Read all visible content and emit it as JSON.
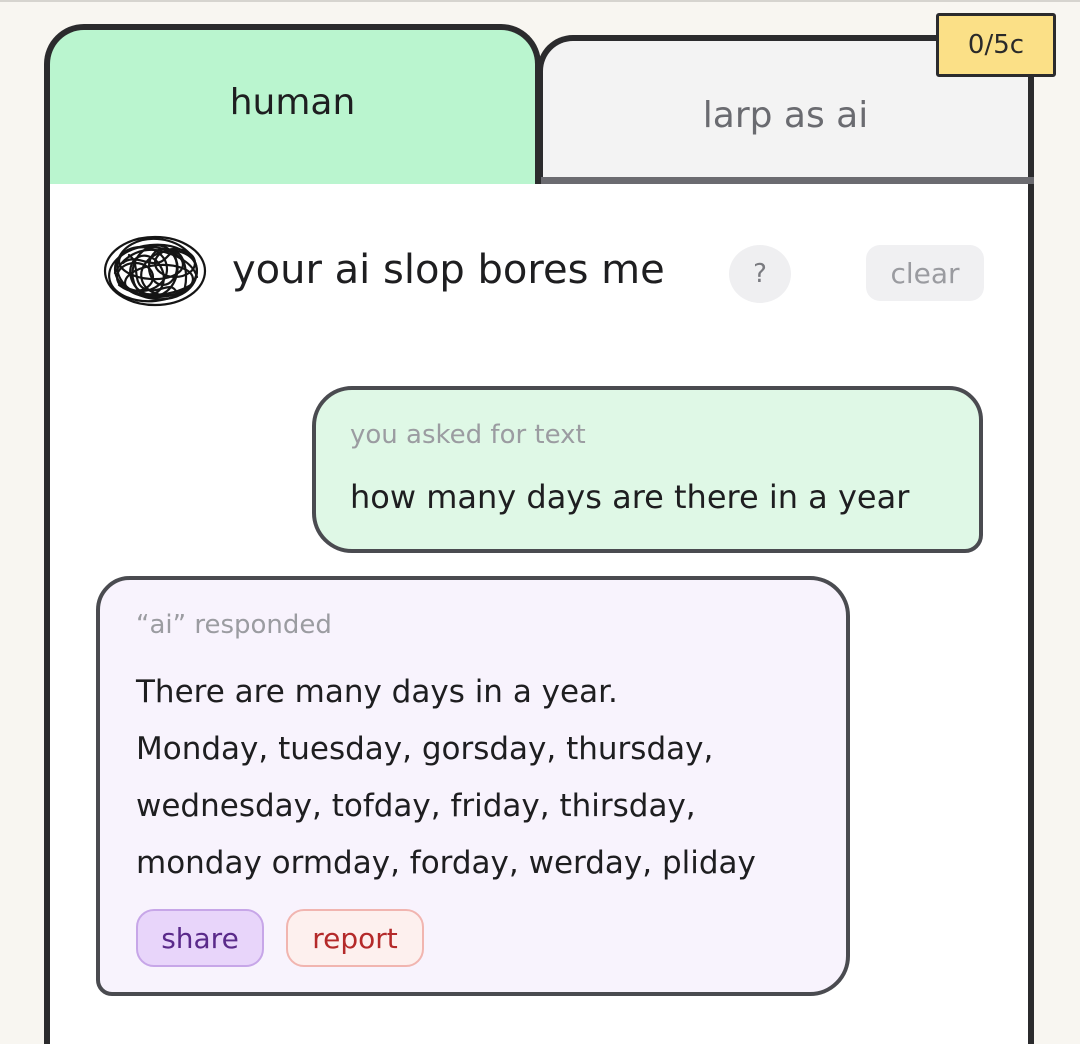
{
  "tabs": [
    {
      "label": "human",
      "active": true
    },
    {
      "label": "larp as ai",
      "active": false
    }
  ],
  "counter": "0/5c",
  "header": {
    "avatar_icon": "scribble-avatar-icon",
    "title": "your ai slop bores me",
    "help_label": "?",
    "clear_label": "clear"
  },
  "conversation": {
    "user": {
      "label": "you asked for text",
      "text": "how many days are there in a year"
    },
    "ai": {
      "label": "“ai” responded",
      "lines": [
        "There are many days in a year.",
        "Monday, tuesday, gorsday, thursday,",
        "wednesday, tofday, friday, thirsday,",
        "monday ormday, forday, werday, pliday"
      ],
      "share_label": "share",
      "report_label": "report"
    }
  },
  "colors": {
    "active_tab": "#baf5cf",
    "inactive_tab": "#f3f3f3",
    "user_bubble": "#dff8e6",
    "ai_bubble": "#f8f3fd",
    "counter_badge": "#fbe087",
    "share": "#e8d5fa",
    "report": "#fdf0ee"
  }
}
